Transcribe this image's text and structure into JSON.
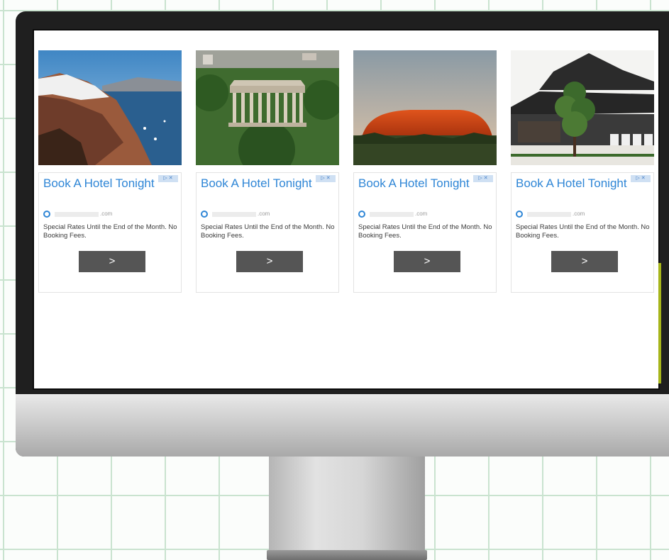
{
  "ads": [
    {
      "scene": "Santorini cliffside village and sea",
      "choice_label": "▷ ✕",
      "title": "Book A Hotel Tonight",
      "domain_suffix": ".com",
      "description": "Special Rates Until the End of the Month. No Booking Fees.",
      "button_label": ">"
    },
    {
      "scene": "Ancient Greek temple among trees",
      "choice_label": "▷ ✕",
      "title": "Book A Hotel Tonight",
      "domain_suffix": ".com",
      "description": "Special Rates Until the End of the Month. No Booking Fees.",
      "button_label": ">"
    },
    {
      "scene": "Red rock monolith at dusk",
      "choice_label": "▷ ✕",
      "title": "Book A Hotel Tonight",
      "domain_suffix": ".com",
      "description": "Special Rates Until the End of the Month. No Booking Fees.",
      "button_label": ">"
    },
    {
      "scene": "Japanese temple with pine tree",
      "choice_label": "▷ ✕",
      "title": "Book A Hotel Tonight",
      "domain_suffix": ".com",
      "description": "Special Rates Until the End of the Month. No Booking Fees.",
      "button_label": ">"
    }
  ],
  "colors": {
    "title_blue": "#2f86d6",
    "button_gray": "#555555",
    "grid_green": "#c9e3cf",
    "bezel": "#1f1f1f"
  }
}
